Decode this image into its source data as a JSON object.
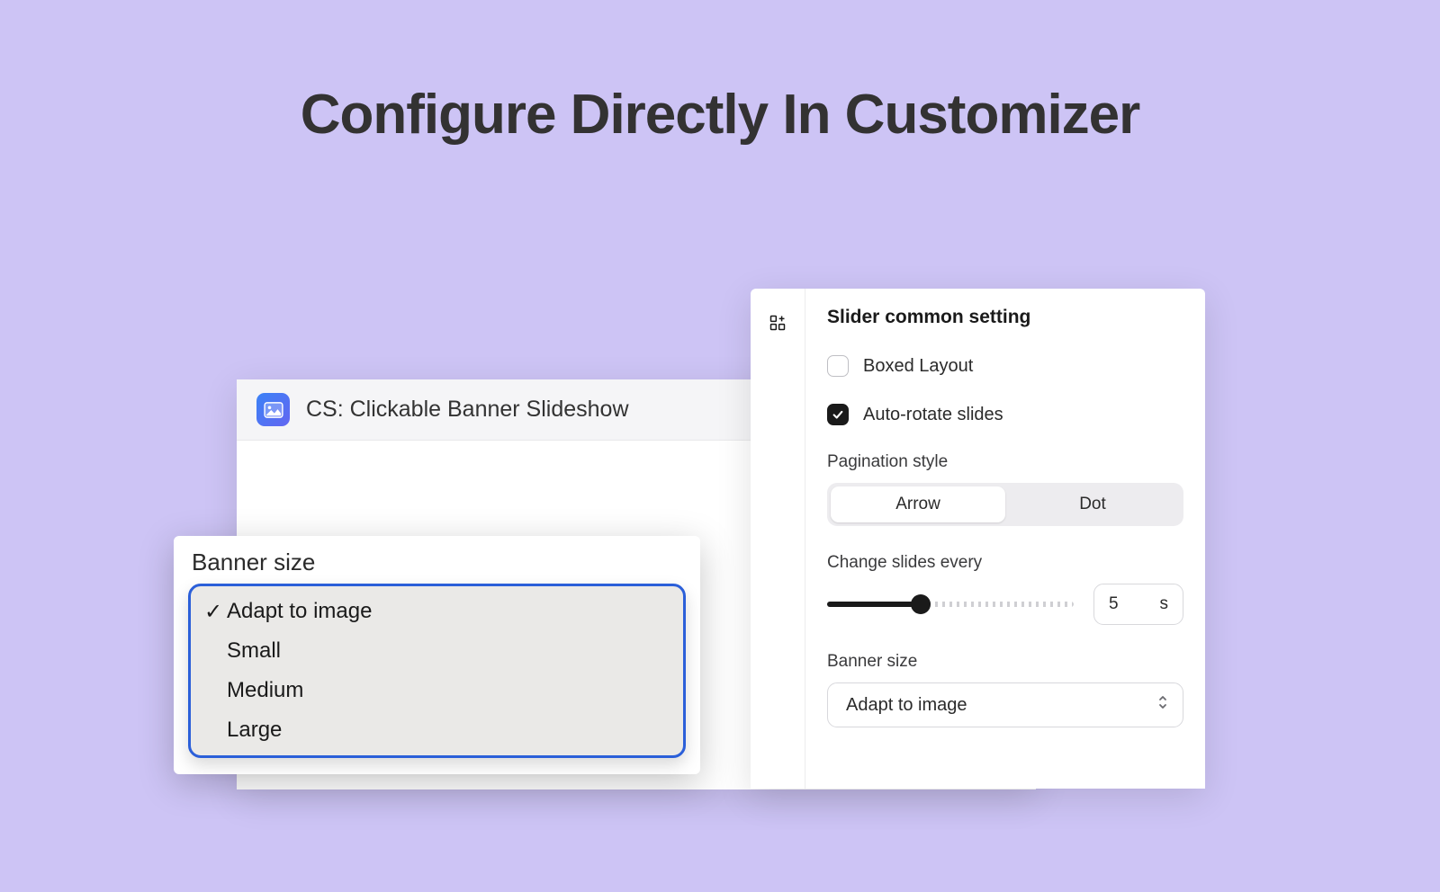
{
  "page_title": "Configure Directly In Customizer",
  "left": {
    "app_name": "CS: Clickable Banner Slideshow"
  },
  "dropdown": {
    "label": "Banner size",
    "selected_index": 0,
    "options": [
      "Adapt to image",
      "Small",
      "Medium",
      "Large"
    ]
  },
  "settings": {
    "section_title": "Slider common setting",
    "boxed_layout": {
      "label": "Boxed Layout",
      "checked": false
    },
    "auto_rotate": {
      "label": "Auto-rotate slides",
      "checked": true
    },
    "pagination": {
      "label": "Pagination style",
      "options": [
        "Arrow",
        "Dot"
      ],
      "active_index": 0
    },
    "interval": {
      "label": "Change slides every",
      "value": "5",
      "unit": "s"
    },
    "banner_size": {
      "label": "Banner size",
      "value": "Adapt to image"
    }
  }
}
